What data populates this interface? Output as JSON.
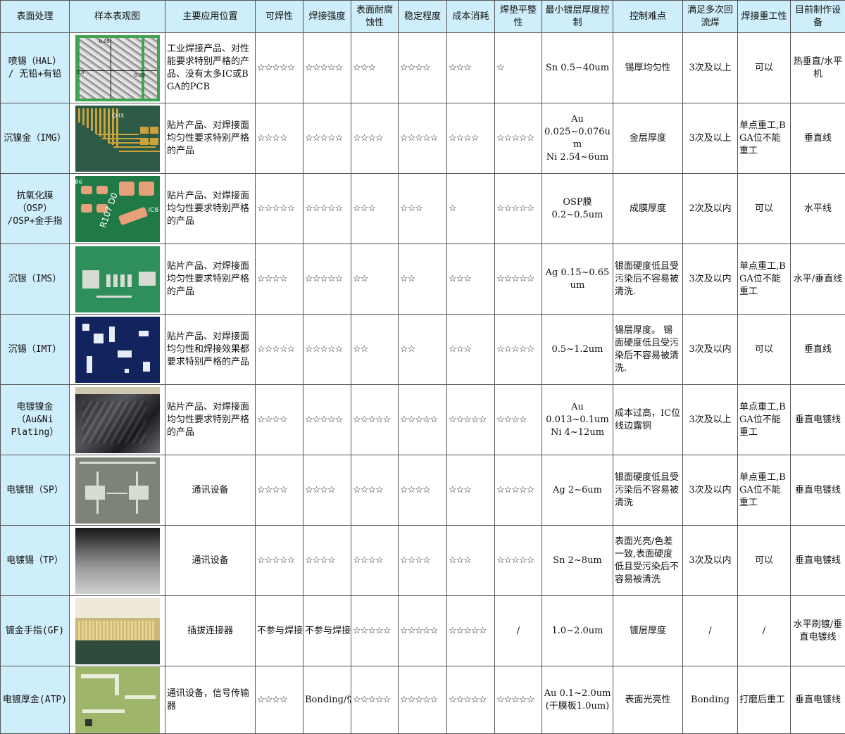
{
  "headers": [
    "表面处理",
    "样本表观图",
    "主要应用位置",
    "可焊性",
    "焊接强度",
    "表面耐腐蚀性",
    "稳定程度",
    "成本消耗",
    "焊垫平整性",
    "最小镀层厚度控制",
    "控制难点",
    "满足多次回流焊",
    "焊接重工性",
    "目前制作设备"
  ],
  "sample_labels": {
    "hal_a": "0.05",
    "hal_b": "0.09",
    "hal_c": "0.0",
    "img_text": "QHX",
    "osp_text": "R107 D0",
    "osp_corner": "86",
    "osp_c6": "IC6"
  },
  "rows": [
    {
      "name_lines": [
        "喷锡（HAL）",
        "/ 无铅+有铅"
      ],
      "app": "工业焊接产品、对性能要求特别严格的产品、没有太多IC或BGA的PCB",
      "solderability": "☆☆☆☆☆",
      "strength": "☆☆☆☆☆",
      "corrosion": "☆☆☆",
      "stability": "☆☆☆☆",
      "cost": "☆☆☆",
      "flatness": "☆",
      "thickness_lines": [
        "Sn 0.5~40um"
      ],
      "difficulty": "锡厚均匀性",
      "reflow": "3次及以上",
      "rework": "可以",
      "equipment": "热垂直/水平机"
    },
    {
      "name_lines": [
        "沉镍金（IMG）"
      ],
      "app": "贴片产品、对焊接面均匀性要求特别严格的产品",
      "solderability": "☆☆☆☆",
      "strength": "☆☆☆☆☆",
      "corrosion": "☆☆☆☆",
      "stability": "☆☆☆☆☆",
      "cost": "☆☆☆☆",
      "flatness": "☆☆☆☆☆",
      "thickness_lines": [
        "Au",
        "0.025~0.076um",
        "Ni 2.54~6um"
      ],
      "difficulty": "金层厚度",
      "reflow": "3次及以上",
      "rework": "单点重工,BGA位不能重工",
      "equipment": "垂直线"
    },
    {
      "name_lines": [
        "抗氧化膜",
        "（OSP）",
        "/OSP+金手指"
      ],
      "app": "贴片产品、对焊接面均匀性要求特别严格的产品",
      "solderability": "☆☆☆☆☆",
      "strength": "☆☆☆☆☆",
      "corrosion": "☆☆☆",
      "stability": "☆☆☆",
      "cost": "☆",
      "flatness": "☆☆☆☆☆",
      "thickness_lines": [
        "OSP膜",
        "0.2~0.5um"
      ],
      "difficulty": "成膜厚度",
      "reflow": "2次及以内",
      "rework": "可以",
      "equipment": "水平线"
    },
    {
      "name_lines": [
        "沉银（IMS）"
      ],
      "app": "贴片产品、对焊接面均匀性要求特别严格的产品",
      "solderability": "☆☆☆☆",
      "strength": "☆☆☆☆☆",
      "corrosion": "☆☆",
      "stability": "☆☆",
      "cost": "☆☆☆",
      "flatness": "☆☆☆☆☆",
      "thickness_lines": [
        "Ag 0.15~0.65um"
      ],
      "difficulty": "银面硬度低且受污染后不容易被清洗.",
      "reflow": "3次及以内",
      "rework": "单点重工,BGA位不能重工",
      "equipment": "水平/垂直线"
    },
    {
      "name_lines": [
        "沉锡（IMT）"
      ],
      "app": "贴片产品、对焊接面均匀性和焊接效果都要求特别严格的产品",
      "solderability": "☆☆☆☆☆",
      "strength": "☆☆☆☆☆",
      "corrosion": "☆☆",
      "stability": "☆☆",
      "cost": "☆☆☆",
      "flatness": "☆☆☆☆☆",
      "thickness_lines": [
        "0.5~1.2um"
      ],
      "difficulty": "锡层厚度。 锡面硬度低且受污染后不容易被清洗.",
      "reflow": "3次及以内",
      "rework": "可以",
      "equipment": "垂直线"
    },
    {
      "name_lines": [
        "电镀镍金",
        "（Au&Ni",
        "Plating）"
      ],
      "app": "贴片产品、对焊接面均匀性要求特别严格的产品",
      "solderability": "☆☆☆☆",
      "strength": "☆☆☆☆☆",
      "corrosion": "☆☆☆☆☆",
      "stability": "☆☆☆☆☆",
      "cost": "☆☆☆☆☆",
      "flatness": "☆☆☆☆",
      "thickness_lines": [
        "Au",
        "0.013~0.1um",
        "Ni 4~12um"
      ],
      "difficulty": "成本过高，IC位线边露铜",
      "reflow": "3次及以上",
      "rework": "单点重工,BGA位不能重工",
      "equipment": "垂直电镀线"
    },
    {
      "name_lines": [
        "电镀银（SP）"
      ],
      "app": "通讯设备",
      "app_center": true,
      "solderability": "☆☆☆☆",
      "strength": "☆☆☆☆",
      "corrosion": "☆☆☆☆",
      "stability": "☆☆☆☆",
      "cost": "☆☆☆",
      "flatness": "☆☆☆☆☆",
      "thickness_lines": [
        "Ag 2~6um"
      ],
      "difficulty": "银面硬度低且受污染后不容易被清洗",
      "reflow": "3次及以内",
      "rework": "单点重工,BGA位不能重工",
      "equipment": "垂直电镀线"
    },
    {
      "name_lines": [
        "电镀锡（TP）"
      ],
      "app": "通讯设备",
      "app_center": true,
      "solderability": "☆☆☆☆☆",
      "strength": "☆☆☆☆",
      "corrosion": "☆☆☆☆",
      "stability": "☆☆☆☆",
      "cost": "☆☆☆",
      "flatness": "☆☆☆☆☆",
      "thickness_lines": [
        "Sn 2~8um"
      ],
      "difficulty": "表面光亮/色差一致,表面硬度低且受污染后不容易被清洗",
      "reflow": "3次及以内",
      "rework": "可以",
      "equipment": "垂直电镀线"
    },
    {
      "name_lines": [
        "镀金手指(GF)"
      ],
      "app": "插拔连接器",
      "app_center": true,
      "solderability": "不参与焊接",
      "strength": "不参与焊接",
      "corrosion": "☆☆☆☆☆",
      "stability": "☆☆☆☆☆",
      "cost": "☆☆☆☆☆",
      "flatness": "/",
      "thickness_lines": [
        "1.0~2.0um"
      ],
      "difficulty": "镀层厚度",
      "reflow": "/",
      "rework": "/",
      "equipment": "水平刷镀/垂直电镀线"
    },
    {
      "name_lines": [
        "电镀厚金(ATP)"
      ],
      "app": "通讯设备，信号传输器",
      "solderability": "☆☆☆☆",
      "strength": "Bonding/信号传输",
      "corrosion": "☆☆☆☆☆",
      "stability": "☆☆☆☆☆",
      "cost": "☆☆☆☆☆",
      "flatness": "☆☆☆☆☆",
      "thickness_lines": [
        "Au 0.1~2.0um",
        "(干膜板1.0um)"
      ],
      "difficulty": "表面光亮性",
      "reflow": "Bonding",
      "rework": "打磨后重工",
      "equipment": "垂直电镀线"
    }
  ]
}
